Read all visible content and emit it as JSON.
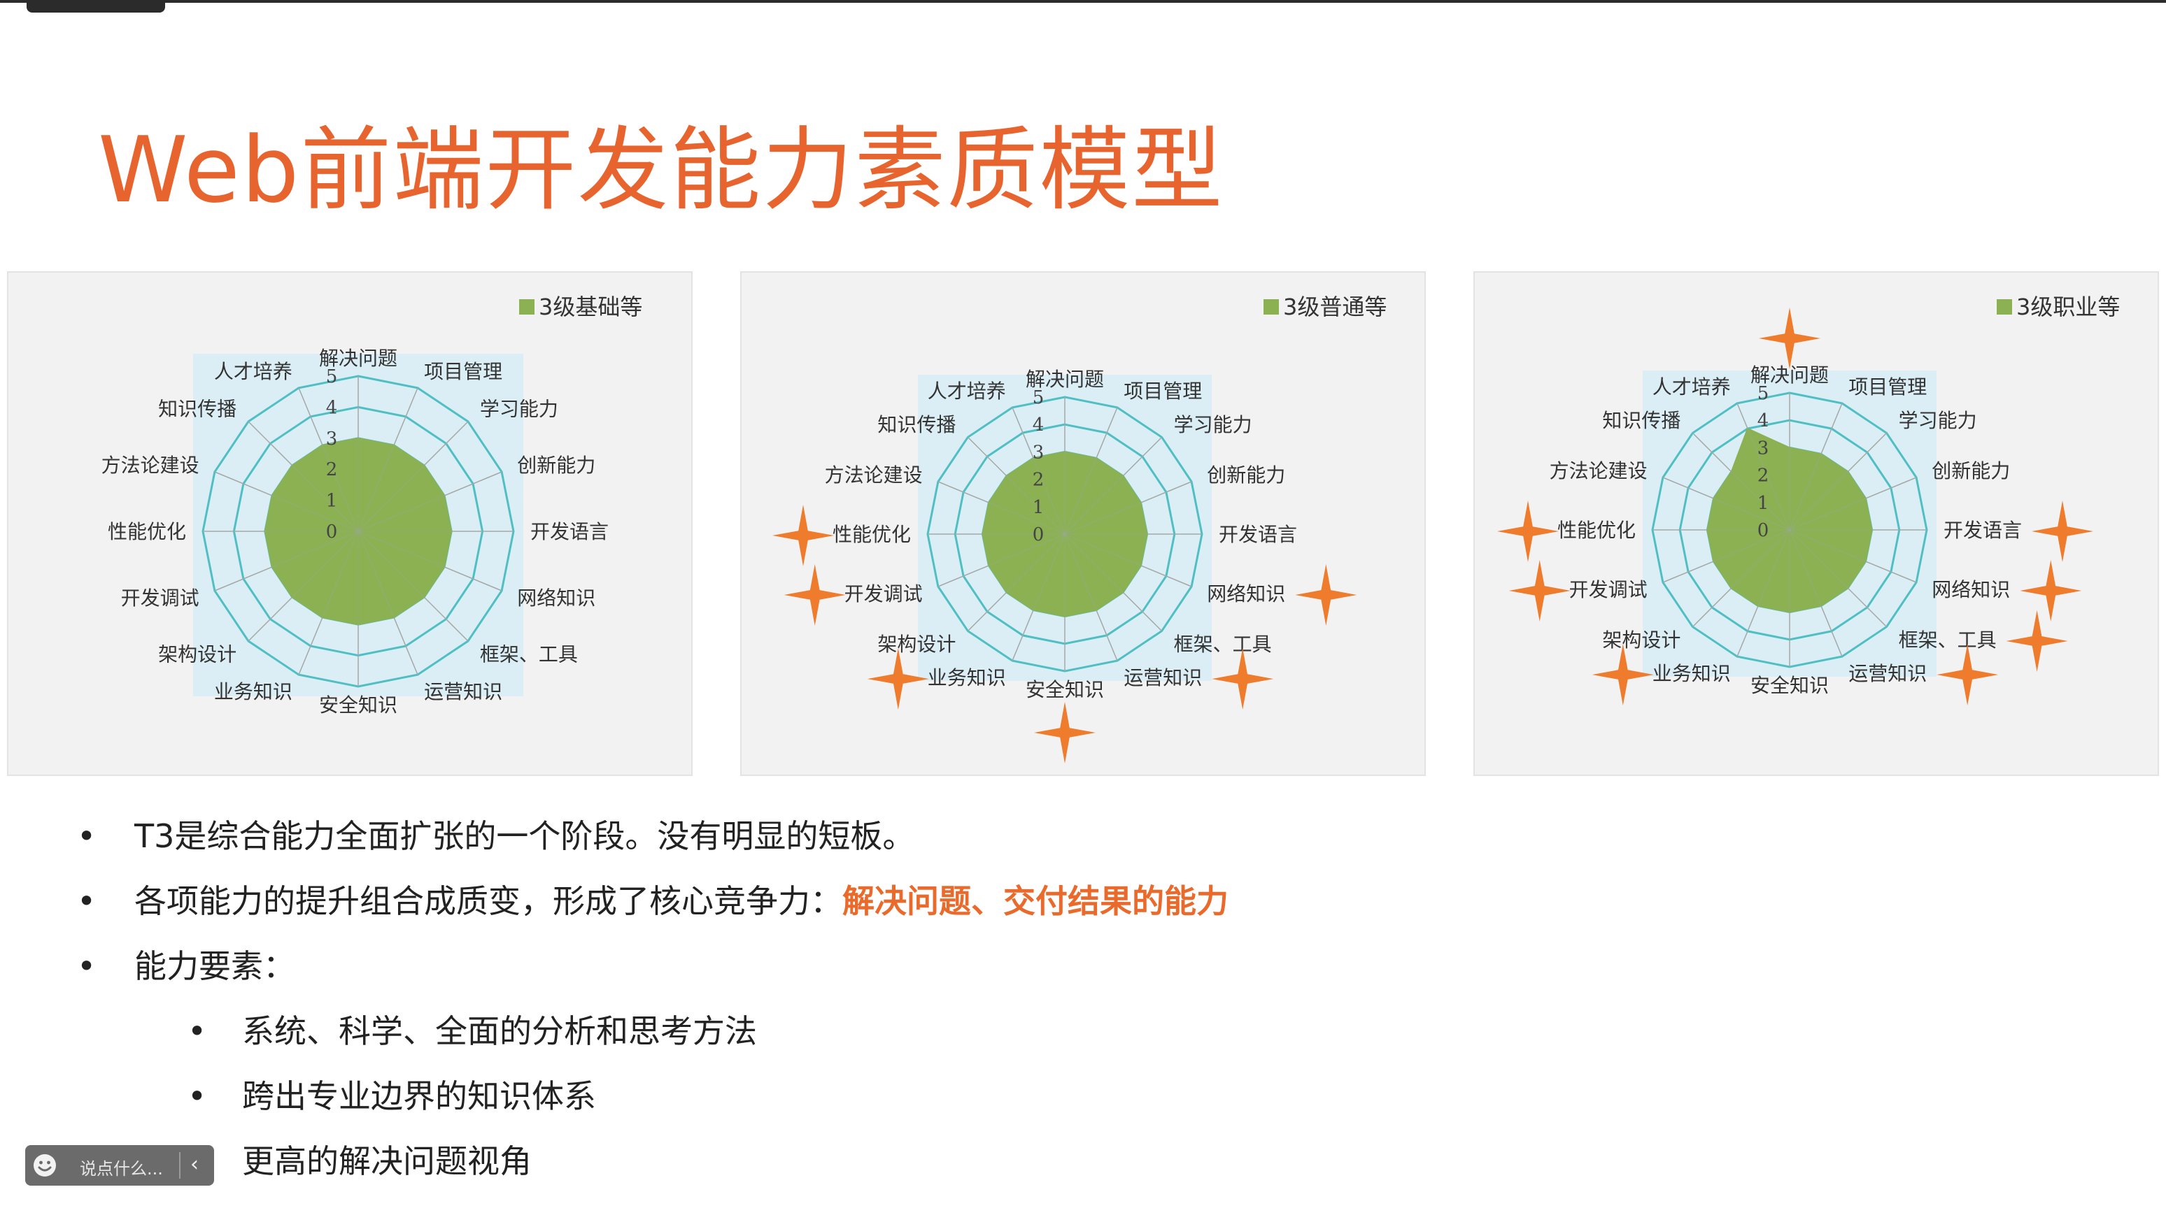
{
  "slide": {
    "title": "Web前端开发能力素质模型"
  },
  "chart_data": [
    {
      "type": "radar",
      "legend": "3级基础等",
      "legend_position": "top-right",
      "axes": [
        "解决问题",
        "项目管理",
        "学习能力",
        "创新能力",
        "开发语言",
        "网络知识",
        "框架、工具",
        "运营知识",
        "安全知识",
        "业务知识",
        "架构设计",
        "开发调试",
        "性能优化",
        "方法论建设",
        "知识传播",
        "人才培养"
      ],
      "ticks": [
        "0",
        "1",
        "2",
        "3",
        "4",
        "5"
      ],
      "range": [
        0,
        5
      ],
      "values": [
        3,
        3,
        3,
        3,
        3,
        3,
        3,
        3,
        3,
        3,
        3,
        3,
        3,
        3,
        3,
        3
      ],
      "fill_color": "#8bb153",
      "starred": []
    },
    {
      "type": "radar",
      "legend": "3级普通等",
      "legend_position": "top-right",
      "axes": [
        "解决问题",
        "项目管理",
        "学习能力",
        "创新能力",
        "开发语言",
        "网络知识",
        "框架、工具",
        "运营知识",
        "安全知识",
        "业务知识",
        "架构设计",
        "开发调试",
        "性能优化",
        "方法论建设",
        "知识传播",
        "人才培养"
      ],
      "ticks": [
        "0",
        "1",
        "2",
        "3",
        "4",
        "5"
      ],
      "range": [
        0,
        5
      ],
      "values": [
        3,
        3,
        3,
        3,
        3,
        3,
        3,
        3,
        3,
        3,
        3,
        3,
        3,
        3,
        3,
        3
      ],
      "fill_color": "#8bb153",
      "starred": [
        "网络知识",
        "运营知识",
        "安全知识",
        "业务知识",
        "开发调试",
        "性能优化"
      ]
    },
    {
      "type": "radar",
      "legend": "3级职业等",
      "legend_position": "top-right",
      "axes": [
        "解决问题",
        "项目管理",
        "学习能力",
        "创新能力",
        "开发语言",
        "网络知识",
        "框架、工具",
        "运营知识",
        "安全知识",
        "业务知识",
        "架构设计",
        "开发调试",
        "性能优化",
        "方法论建设",
        "知识传播",
        "人才培养"
      ],
      "ticks": [
        "0",
        "1",
        "2",
        "3",
        "4",
        "5"
      ],
      "range": [
        0,
        5
      ],
      "values": [
        3,
        3,
        3,
        3,
        3,
        3,
        3,
        3,
        3,
        3,
        3,
        3,
        3,
        3,
        3,
        4
      ],
      "fill_color": "#8bb153",
      "starred": [
        "解决问题",
        "开发语言",
        "网络知识",
        "框架、工具",
        "运营知识",
        "业务知识",
        "开发调试",
        "性能优化"
      ]
    }
  ],
  "bullets": [
    {
      "text": "T3是综合能力全面扩张的一个阶段。没有明显的短板。"
    },
    {
      "text": "各项能力的提升组合成质变，形成了核心竞争力：",
      "highlight": "解决问题、交付结果的能力"
    },
    {
      "text": "能力要素："
    }
  ],
  "sub_bullets": [
    {
      "text": "系统、科学、全面的分析和思考方法"
    },
    {
      "text": "跨出专业边界的知识体系"
    },
    {
      "text": "更高的解决问题视角"
    }
  ],
  "bullet_symbol": "•",
  "comment_input": {
    "placeholder": "说点什么...",
    "chevron": "‹"
  },
  "colors": {
    "title": "#e8642f",
    "highlight": "#ea6a2c",
    "radar_fill": "#8bb153",
    "radar_grid": "#4fbfc3",
    "radar_bg": "#dbeef5",
    "star": "#ef7b2c"
  }
}
